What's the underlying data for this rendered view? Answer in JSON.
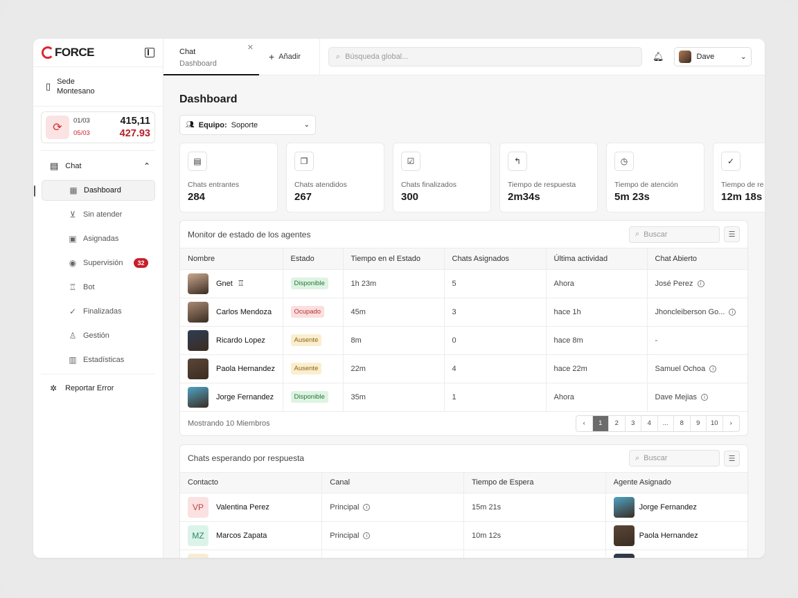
{
  "brand": {
    "logo_text": "FORCE",
    "accent": "#e0252c"
  },
  "sidebar": {
    "location": "Sede\nMontesano",
    "location_line1": "Sede",
    "location_line2": "Montesano",
    "exchange": {
      "date1": "01/03",
      "date2": "05/03",
      "val1": "415,11",
      "val2": "427.93"
    },
    "chat_section": "Chat",
    "items": [
      {
        "label": "Dashboard",
        "icon": "grid-icon",
        "glyph": "▦"
      },
      {
        "label": "Sin atender",
        "icon": "inbox-download-icon",
        "glyph": "⊻"
      },
      {
        "label": "Asignadas",
        "icon": "assigned-user-icon",
        "glyph": "▣"
      },
      {
        "label": "Supervisión",
        "icon": "eye-icon",
        "glyph": "◉",
        "badge": "32"
      },
      {
        "label": "Bot",
        "icon": "bot-icon",
        "glyph": "♖"
      },
      {
        "label": "Finalizadas",
        "icon": "check-circle-icon",
        "glyph": "✓"
      },
      {
        "label": "Gestión",
        "icon": "user-manage-icon",
        "glyph": "♙"
      },
      {
        "label": "Estadísticas",
        "icon": "stats-icon",
        "glyph": "▥"
      }
    ],
    "report": "Reportar Error"
  },
  "topbar": {
    "tab": {
      "title": "Chat",
      "subtitle": "Dashboard"
    },
    "add_label": "Añadir",
    "search_placeholder": "Búsqueda global...",
    "user_name": "Dave"
  },
  "page": {
    "title": "Dashboard",
    "team_label": "Equipo:",
    "team_value": "Soporte"
  },
  "stats": [
    {
      "label": "Chats entrantes",
      "value": "284",
      "icon": "chat-lines-icon",
      "glyph": "▤"
    },
    {
      "label": "Chats atendidos",
      "value": "267",
      "icon": "chat-double-icon",
      "glyph": "❐"
    },
    {
      "label": "Chats finalizados",
      "value": "300",
      "icon": "chat-check-icon",
      "glyph": "☑"
    },
    {
      "label": "Tiempo de respuesta",
      "value": "2m34s",
      "icon": "reply-icon",
      "glyph": "↰"
    },
    {
      "label": "Tiempo de atención",
      "value": "5m 23s",
      "icon": "clock-icon",
      "glyph": "◷"
    },
    {
      "label": "Tiempo de re",
      "value": "12m 18s",
      "icon": "check-circle-icon",
      "glyph": "✓"
    }
  ],
  "agents": {
    "title": "Monitor de estado de los agentes",
    "search_placeholder": "Buscar",
    "columns": [
      "Nombre",
      "Estado",
      "Tiempo en el Estado",
      "Chats Asignados",
      "Última actividad",
      "Chat Abierto"
    ],
    "rows": [
      {
        "name": "Gnet",
        "bot": "♖",
        "status": "Disponible",
        "kind": "ok",
        "time": "1h 23m",
        "chats": "5",
        "last": "Ahora",
        "open": "José Perez",
        "info": true,
        "av": "#c9a98f"
      },
      {
        "name": "Carlos Mendoza",
        "status": "Ocupado",
        "kind": "busy",
        "time": "45m",
        "chats": "3",
        "last": "hace 1h",
        "open": "Jhoncleiberson Go...",
        "info": true,
        "av": "#a98a74"
      },
      {
        "name": "Ricardo Lopez",
        "status": "Ausente",
        "kind": "away",
        "time": "8m",
        "chats": "0",
        "last": "hace 8m",
        "open": "-",
        "info": false,
        "av": "#2d3d52"
      },
      {
        "name": "Paola Hernandez",
        "status": "Ausente",
        "kind": "away",
        "time": "22m",
        "chats": "4",
        "last": "hace 22m",
        "open": "Samuel Ochoa",
        "info": true,
        "av": "#5a4637"
      },
      {
        "name": "Jorge Fernandez",
        "status": "Disponible",
        "kind": "ok",
        "time": "35m",
        "chats": "1",
        "last": "Ahora",
        "open": "Dave Mejias",
        "info": true,
        "av": "#4fa3c4"
      }
    ],
    "footer": "Mostrando 10 Miembros",
    "pages": [
      "1",
      "2",
      "3",
      "4",
      "...",
      "8",
      "9",
      "10"
    ]
  },
  "waiting": {
    "title": "Chats esperando por respuesta",
    "search_placeholder": "Buscar",
    "columns": [
      "Contacto",
      "Canal",
      "Tiempo de Espera",
      "Agente Asignado"
    ],
    "rows": [
      {
        "initials": "VP",
        "contact": "Valentina Perez",
        "channel": "Principal",
        "wait": "15m 21s",
        "agent": "Jorge Fernandez",
        "bg": "#fbe1e1",
        "fg": "#c04343",
        "av": "#4fa3c4"
      },
      {
        "initials": "MZ",
        "contact": "Marcos Zapata",
        "channel": "Principal",
        "wait": "10m 12s",
        "agent": "Paola Hernandez",
        "bg": "#dcf3ea",
        "fg": "#2b8c63",
        "av": "#5a4637"
      },
      {
        "initials": "",
        "contact": "",
        "channel": "",
        "wait": "",
        "agent": "",
        "bg": "#f7edd4",
        "fg": "#8a6312",
        "av": "#2d3d52"
      }
    ]
  }
}
